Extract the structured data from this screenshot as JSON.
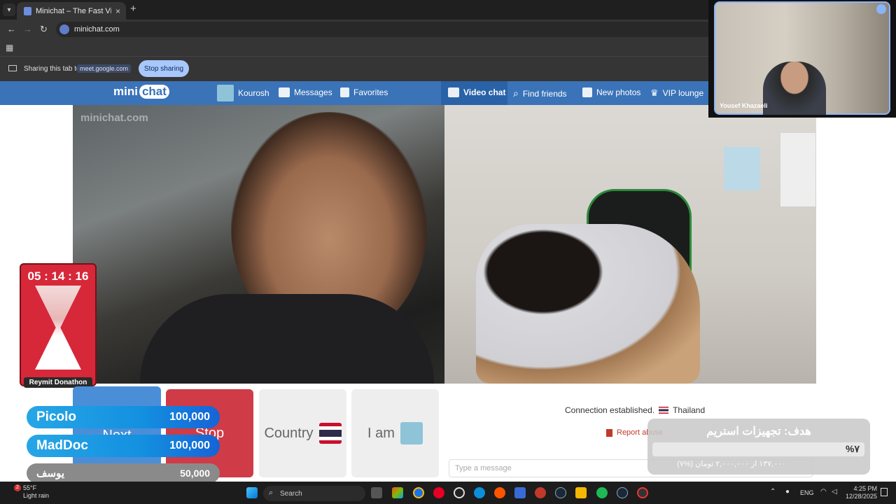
{
  "browser": {
    "tab_title": "Minichat – The Fast Video C",
    "tab_close": "×",
    "new_tab": "+",
    "url": "minichat.com",
    "sharing_text": "Sharing this tab to",
    "sharing_target": "meet.google.com",
    "stop_sharing": "Stop sharing"
  },
  "site": {
    "logo_mini": "mini",
    "logo_chat": "chat",
    "nav": {
      "user": "Kourosh",
      "messages": "Messages",
      "favorites": "Favorites",
      "video_chat": "Video chat",
      "find_friends": "Find friends",
      "new_photos": "New photos",
      "vip_lounge": "VIP lounge"
    },
    "watermark": "minichat.com",
    "buttons": {
      "next": "Next",
      "stop": "Stop",
      "country": "Country",
      "i_am": "I am"
    },
    "connection_text": "Connection established.",
    "connection_country": "Thailand",
    "report_abuse": "Report abuse",
    "message_placeholder": "Type a message"
  },
  "overlay": {
    "timer": "05 : 14 : 16",
    "timer_name": "Reymit Donathon",
    "donations": [
      {
        "name": "Picolo",
        "amount": "100,000"
      },
      {
        "name": "MadDoc",
        "amount": "100,000"
      },
      {
        "name": "یوسف",
        "amount": "50,000"
      }
    ],
    "goal_title": "هدف: تجهیزات استریم",
    "goal_percent": "%۷",
    "goal_sub": "۱۳۷,۰۰۰ از ۲,۰۰۰,۰۰۰ تومان (%۷)"
  },
  "camera": {
    "name": "Yousef Khazaeli"
  },
  "taskbar": {
    "weather_badge": "2",
    "weather_temp": "55°F",
    "weather_desc": "Light rain",
    "search": "Search",
    "lang": "ENG",
    "time": "4:25 PM",
    "date": "12/28/2025"
  },
  "colors": {
    "nav_blue": "#3a73b8",
    "next_blue": "#4a8ed8",
    "stop_red": "#cf3b46",
    "timer_red": "#d62839"
  }
}
